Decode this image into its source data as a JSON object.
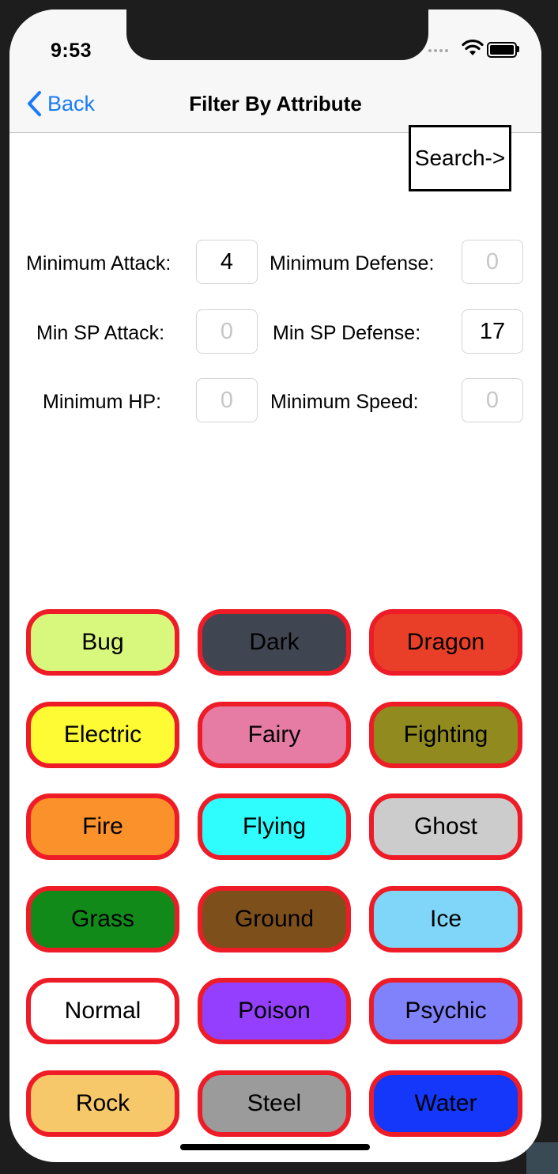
{
  "status_bar": {
    "time": "9:53"
  },
  "nav": {
    "back_label": "Back",
    "title": "Filter By Attribute"
  },
  "search_button": {
    "label": "Search->"
  },
  "filters": [
    {
      "label": "Minimum Attack:",
      "value": "4",
      "placeholder": "0"
    },
    {
      "label": "Minimum Defense:",
      "value": "",
      "placeholder": "0"
    },
    {
      "label": "Min SP Attack:",
      "value": "",
      "placeholder": "0"
    },
    {
      "label": "Min SP Defense:",
      "value": "17",
      "placeholder": "0"
    },
    {
      "label": "Minimum HP:",
      "value": "",
      "placeholder": "0"
    },
    {
      "label": "Minimum Speed:",
      "value": "",
      "placeholder": "0"
    }
  ],
  "types": [
    {
      "label": "Bug",
      "color": "#d8f87d"
    },
    {
      "label": "Dark",
      "color": "#404651"
    },
    {
      "label": "Dragon",
      "color": "#e93f29"
    },
    {
      "label": "Electric",
      "color": "#fefa33"
    },
    {
      "label": "Fairy",
      "color": "#e67ba3"
    },
    {
      "label": "Fighting",
      "color": "#908a1f"
    },
    {
      "label": "Fire",
      "color": "#fb912b"
    },
    {
      "label": "Flying",
      "color": "#2ffdfd"
    },
    {
      "label": "Ghost",
      "color": "#cccccc"
    },
    {
      "label": "Grass",
      "color": "#128a1a"
    },
    {
      "label": "Ground",
      "color": "#7c4f1b"
    },
    {
      "label": "Ice",
      "color": "#80d6f8"
    },
    {
      "label": "Normal",
      "color": "#ffffff"
    },
    {
      "label": "Poison",
      "color": "#943ffd"
    },
    {
      "label": "Psychic",
      "color": "#8082fc"
    },
    {
      "label": "Rock",
      "color": "#f6c86a"
    },
    {
      "label": "Steel",
      "color": "#9b9b9b"
    },
    {
      "label": "Water",
      "color": "#1437fa"
    }
  ],
  "colors": {
    "accent": "#1b7bf5",
    "type_border": "#ee1c27"
  }
}
